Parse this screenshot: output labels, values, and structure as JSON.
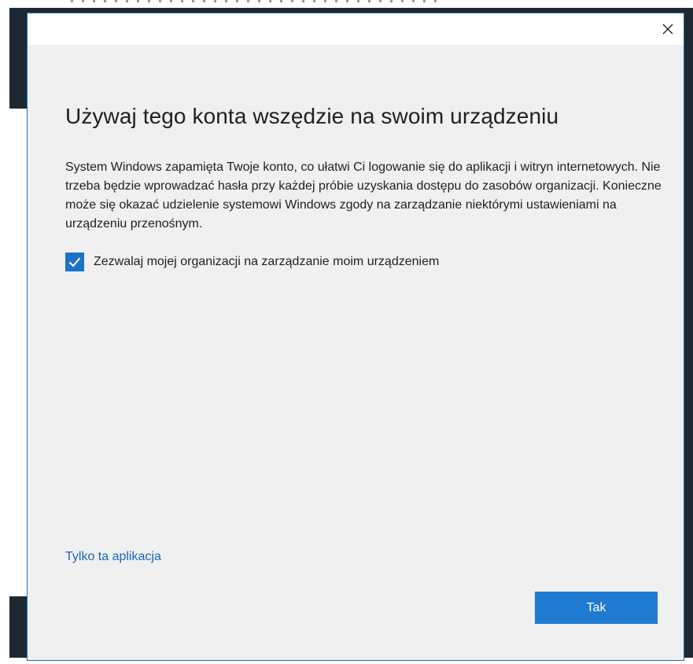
{
  "dialog": {
    "heading": "Używaj tego konta wszędzie na swoim urządzeniu",
    "description": "System Windows zapamięta Twoje konto, co ułatwi Ci logowanie się do aplikacji i witryn internetowych. Nie trzeba będzie wprowadzać hasła przy każdej próbie uzyskania dostępu do zasobów organizacji. Konieczne może się okazać udzielenie systemowi Windows zgody na zarządzanie niektórymi ustawieniami na urządzeniu przenośnym.",
    "checkbox": {
      "label": "Zezwalaj mojej organizacji na zarządzanie moim urządzeniem",
      "checked": true
    },
    "link_label": "Tylko ta aplikacja",
    "primary_button_label": "Tak",
    "close_icon": "close-icon"
  },
  "colors": {
    "accent": "#1f7ad1",
    "link": "#1a66b8",
    "dialog_bg": "#f0f0f0",
    "dialog_border": "#1f6fb5",
    "desktop": "#1d2833"
  }
}
